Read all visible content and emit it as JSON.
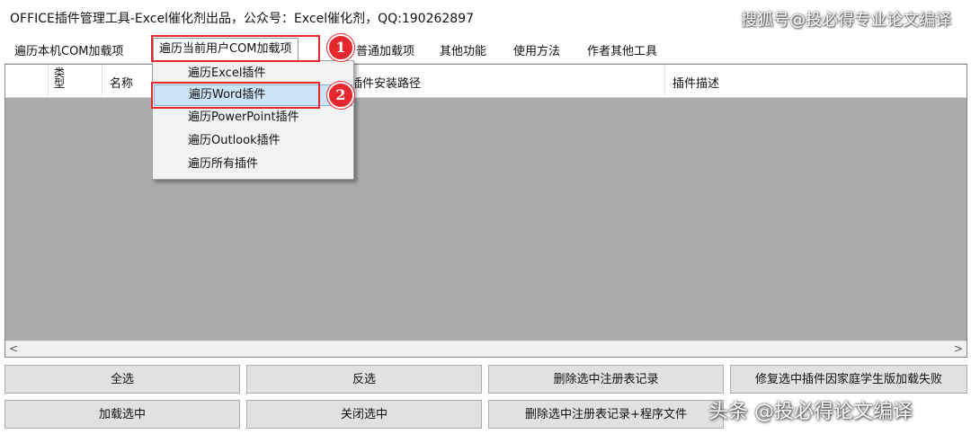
{
  "window": {
    "title": "OFFICE插件管理工具-Excel催化剂出品，公众号：Excel催化剂，QQ:190262897"
  },
  "watermarks": {
    "top": "搜狐号@投必得专业论文编译",
    "bottom": "头条 @投必得论文编译"
  },
  "menu": {
    "items": [
      "遍历本机COM加载项",
      "遍历当前用户COM加载项",
      "普通加载项",
      "其他功能",
      "使用方法",
      "作者其他工具"
    ]
  },
  "dropdown": {
    "items": [
      "遍历Excel插件",
      "遍历Word插件",
      "遍历PowerPoint插件",
      "遍历Outlook插件",
      "遍历所有插件"
    ],
    "selected_index": 1
  },
  "annotations": {
    "badge1": "1",
    "badge2": "2",
    "color": "#e5282e"
  },
  "table": {
    "columns": [
      "类型",
      "名称",
      "插件安装路径",
      "插件描述"
    ],
    "rows": []
  },
  "scrollbar": {
    "left_arrow": "<",
    "right_arrow": ">"
  },
  "buttons": {
    "select_all": "全选",
    "invert_select": "反选",
    "delete_registry": "删除选中注册表记录",
    "repair_home_edition": "修复选中插件因家庭学生版加载失败",
    "load_selected": "加载选中",
    "close_selected": "关闭选中",
    "delete_registry_and_files": "删除选中注册表记录+程序文件"
  }
}
